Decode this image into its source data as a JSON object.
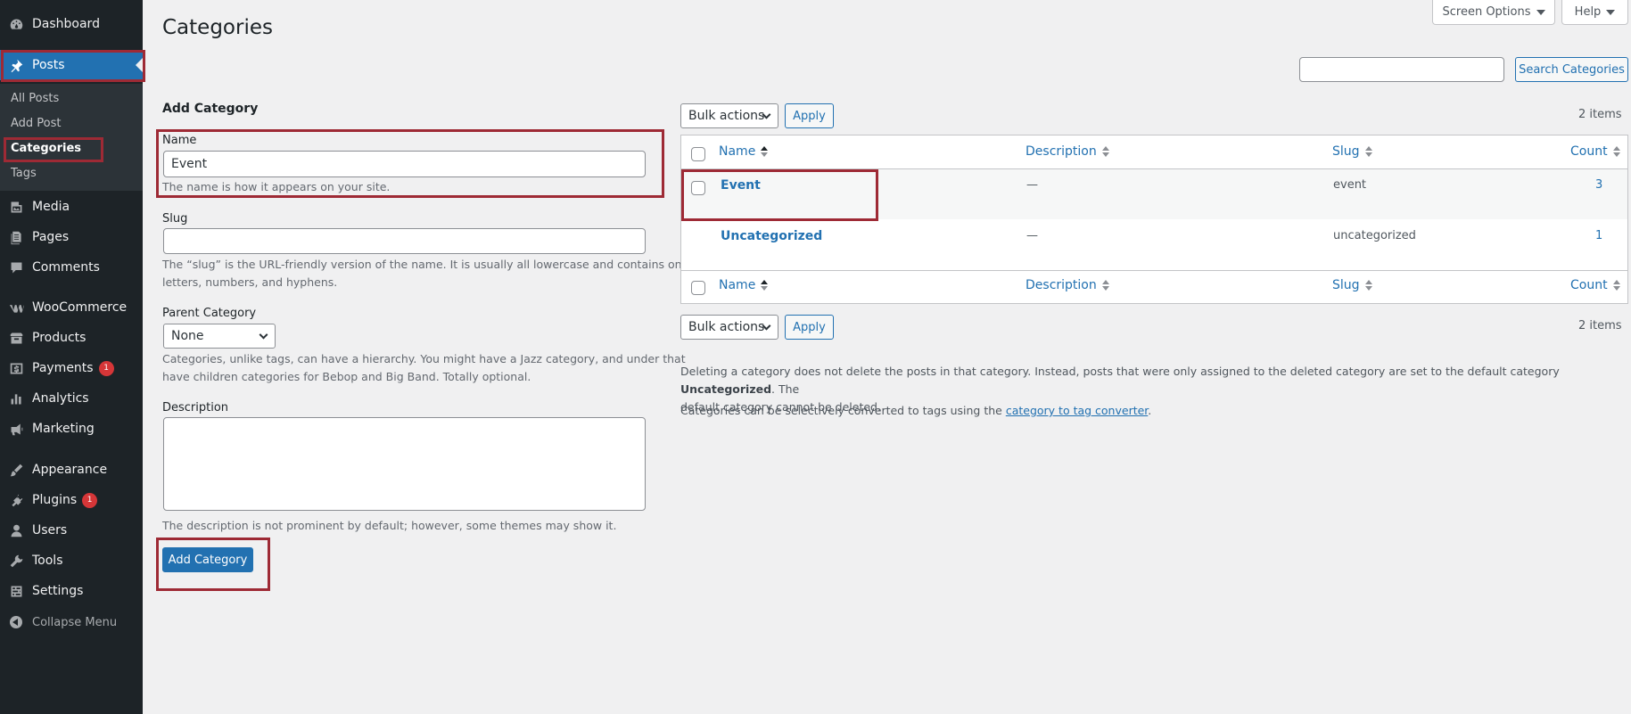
{
  "sidebar": {
    "items": [
      {
        "label": "Dashboard",
        "icon": "dashboard-icon"
      },
      {
        "label": "Posts",
        "icon": "pin-icon"
      },
      {
        "label": "Media",
        "icon": "media-icon"
      },
      {
        "label": "Pages",
        "icon": "pages-icon"
      },
      {
        "label": "Comments",
        "icon": "comments-icon"
      },
      {
        "label": "WooCommerce",
        "icon": "woocommerce-icon"
      },
      {
        "label": "Products",
        "icon": "products-icon"
      },
      {
        "label": "Payments",
        "icon": "payments-icon",
        "badge": "1"
      },
      {
        "label": "Analytics",
        "icon": "analytics-icon"
      },
      {
        "label": "Marketing",
        "icon": "marketing-icon"
      },
      {
        "label": "Appearance",
        "icon": "appearance-icon"
      },
      {
        "label": "Plugins",
        "icon": "plugins-icon",
        "badge": "1"
      },
      {
        "label": "Users",
        "icon": "users-icon"
      },
      {
        "label": "Tools",
        "icon": "tools-icon"
      },
      {
        "label": "Settings",
        "icon": "settings-icon"
      }
    ],
    "submenu": [
      "All Posts",
      "Add Post",
      "Categories",
      "Tags"
    ],
    "collapse_label": "Collapse Menu"
  },
  "header": {
    "screen_options": "Screen Options",
    "help": "Help",
    "title": "Categories"
  },
  "search": {
    "value": "",
    "button": "Search Categories"
  },
  "form": {
    "heading": "Add Category",
    "name_label": "Name",
    "name_value": "Event",
    "name_help": "The name is how it appears on your site.",
    "slug_label": "Slug",
    "slug_value": "",
    "slug_help_1": "The “slug” is the URL-friendly version of the name. It is usually all lowercase and contains only",
    "slug_help_2": "letters, numbers, and hyphens.",
    "parent_label": "Parent Category",
    "parent_value": "None",
    "parent_help_1": "Categories, unlike tags, can have a hierarchy. You might have a Jazz category, and under that",
    "parent_help_2": "have children categories for Bebop and Big Band. Totally optional.",
    "description_label": "Description",
    "description_value": "",
    "description_help": "The description is not prominent by default; however, some themes may show it.",
    "submit": "Add Category"
  },
  "table": {
    "bulk_actions": "Bulk actions",
    "apply": "Apply",
    "items_count": "2 items",
    "columns": [
      "Name",
      "Description",
      "Slug",
      "Count"
    ],
    "rows": [
      {
        "name": "Event",
        "description": "—",
        "slug": "event",
        "count": "3"
      },
      {
        "name": "Uncategorized",
        "description": "—",
        "slug": "uncategorized",
        "count": "1"
      }
    ]
  },
  "notes": {
    "line1_a": "Deleting a category does not delete the posts in that category. Instead, posts that were only assigned to the deleted category are set to the default category ",
    "line1_bold": "Uncategorized",
    "line1_b": ". The",
    "line2": "default category cannot be deleted.",
    "line3_a": "Categories can be selectively converted to tags using the ",
    "line3_link": "category to tag converter",
    "line3_b": "."
  },
  "colors": {
    "sidebar_bg": "#1d2327",
    "accent": "#2271b1",
    "highlight": "#9e2a35",
    "badge": "#d63638"
  }
}
